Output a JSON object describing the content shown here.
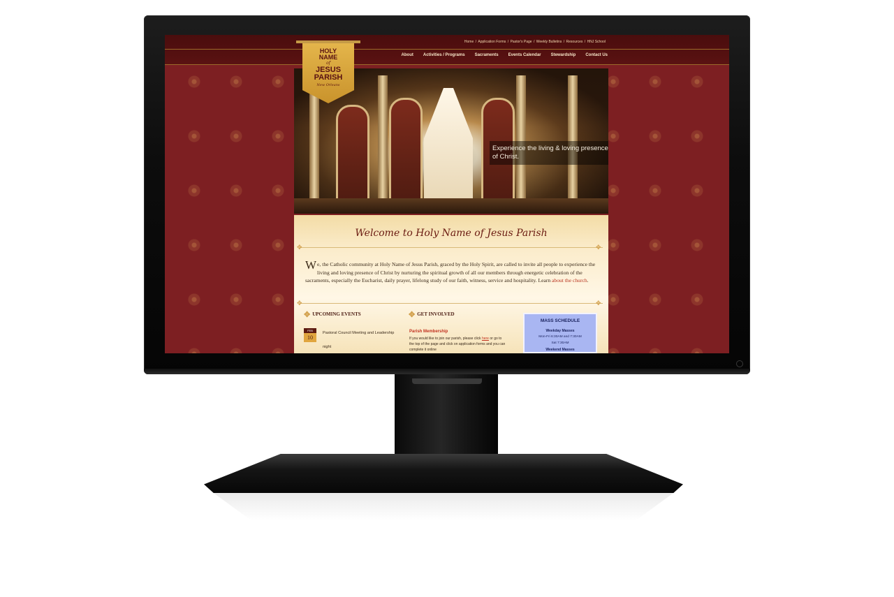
{
  "site": {
    "utility_links": [
      "Home",
      "Application Forms",
      "Pastor's Page",
      "Weekly Bulletins",
      "Resources",
      "HNJ School"
    ],
    "nav": [
      "About",
      "Activities / Programs",
      "Sacraments",
      "Events Calendar",
      "Stewardship",
      "Contact Us"
    ],
    "logo": {
      "line1": "HOLY",
      "line2": "NAME",
      "line3": "of",
      "line4": "JESUS",
      "line5": "PARISH",
      "line6": "New Orleans"
    },
    "hero_caption": "Experience the living & loving presence of Christ.",
    "welcome_title": "Welcome to Holy Name of Jesus Parish",
    "intro": {
      "dropcap": "W",
      "text": "e, the Catholic community at Holy Name of Jesus Parish, graced by the Holy Spirit, are called to invite all people to experience the living and loving presence of Christ by nurturing the spiritual growth of all our members through energetic celebration of the sacraments, especially the Eucharist, daily prayer, lifelong study of our faith, witness, service and hospitality. Learn ",
      "link": "about the church",
      "end": "."
    },
    "upcoming_events": {
      "heading": "UPCOMING EVENTS",
      "month": "FEB",
      "day": "10",
      "title": "Pastoral Council Meeting and Leadership",
      "more": "night"
    },
    "get_involved": {
      "heading": "GET INVOLVED",
      "item_title": "Parish Membership",
      "text_before": "If you would like to join our parish, please click ",
      "link": "here",
      "text_after": " or go to the top of the page and click on application forms and you can complete it online"
    },
    "mass_schedule": {
      "heading": "MASS SCHEDULE",
      "weekday_label": "Weekday Masses",
      "weekday_times": "Mon-Fri 6:30AM and 7:30AM",
      "saturday": "Sat 7:30AM",
      "weekend_label": "Weekend Masses"
    }
  },
  "colors": {
    "background_red": "#7d1f22",
    "header_dark": "#4a0d0d",
    "gold": "#d2a04c",
    "mass_box": "#a9b6f2"
  }
}
